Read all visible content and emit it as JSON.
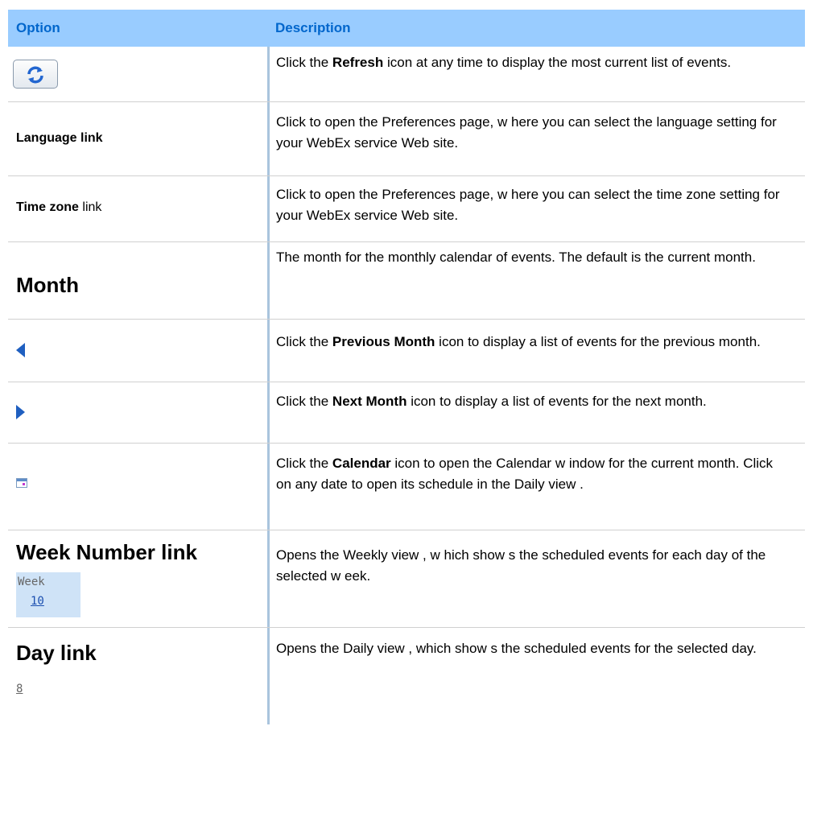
{
  "header": {
    "option": "Option",
    "description": "Description"
  },
  "rows": [
    {
      "icon": "refresh-icon",
      "desc_pre": "Click the ",
      "desc_bold": "Refresh",
      "desc_post": " icon at any time to display the most current list of events."
    },
    {
      "option_bold": "Language link",
      "desc": "Click to open the Preferences page, w here you can select the language setting for your WebEx service Web site."
    },
    {
      "option_bold": "Time zone",
      "option_normal": " link",
      "desc": "Click to open the Preferences page, w here you can select the time zone setting for your WebEx service Web site."
    },
    {
      "option_bold": "Month",
      "desc": "The month for the monthly calendar of events. The default is the current month."
    },
    {
      "icon": "previous-month-icon",
      "desc_pre": "Click the ",
      "desc_bold": "Previous Month",
      "desc_post": " icon to display a list of events for the previous month."
    },
    {
      "icon": "next-month-icon",
      "desc_pre": "Click the ",
      "desc_bold": "Next Month",
      "desc_post": " icon to display a list of events for the next month."
    },
    {
      "icon": "calendar-icon",
      "desc_pre": "Click the ",
      "desc_bold": "Calendar",
      "desc_post": " icon to open the Calendar w indow for the current month. Click on any date to open its schedule in the Daily view ."
    },
    {
      "option_bold": "Week Number link",
      "widget_label": "Week",
      "widget_value": "10",
      "desc": "Opens the Weekly view , w hich show s the scheduled events for each day of the selected w eek."
    },
    {
      "option_bold": "Day link",
      "widget_value": "8",
      "desc": "Opens the Daily view , which show s the scheduled events for the selected day."
    }
  ],
  "colors": {
    "header_bg": "#99ccff",
    "header_text": "#0066cc",
    "divider": "#a9c4dd",
    "icon_blue": "#1f5fc0"
  }
}
